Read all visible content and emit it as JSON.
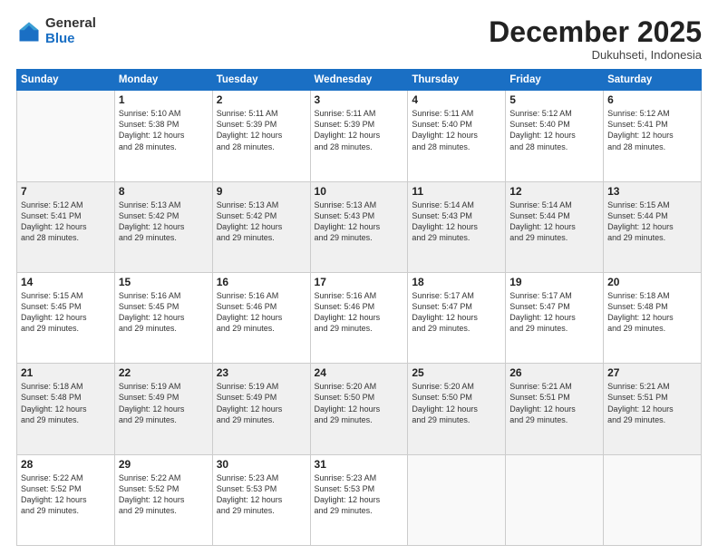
{
  "header": {
    "logo_general": "General",
    "logo_blue": "Blue",
    "month_title": "December 2025",
    "subtitle": "Dukuhseti, Indonesia"
  },
  "weekdays": [
    "Sunday",
    "Monday",
    "Tuesday",
    "Wednesday",
    "Thursday",
    "Friday",
    "Saturday"
  ],
  "weeks": [
    [
      {
        "day": "",
        "info": ""
      },
      {
        "day": "1",
        "info": "Sunrise: 5:10 AM\nSunset: 5:38 PM\nDaylight: 12 hours\nand 28 minutes."
      },
      {
        "day": "2",
        "info": "Sunrise: 5:11 AM\nSunset: 5:39 PM\nDaylight: 12 hours\nand 28 minutes."
      },
      {
        "day": "3",
        "info": "Sunrise: 5:11 AM\nSunset: 5:39 PM\nDaylight: 12 hours\nand 28 minutes."
      },
      {
        "day": "4",
        "info": "Sunrise: 5:11 AM\nSunset: 5:40 PM\nDaylight: 12 hours\nand 28 minutes."
      },
      {
        "day": "5",
        "info": "Sunrise: 5:12 AM\nSunset: 5:40 PM\nDaylight: 12 hours\nand 28 minutes."
      },
      {
        "day": "6",
        "info": "Sunrise: 5:12 AM\nSunset: 5:41 PM\nDaylight: 12 hours\nand 28 minutes."
      }
    ],
    [
      {
        "day": "7",
        "info": "Sunrise: 5:12 AM\nSunset: 5:41 PM\nDaylight: 12 hours\nand 28 minutes."
      },
      {
        "day": "8",
        "info": "Sunrise: 5:13 AM\nSunset: 5:42 PM\nDaylight: 12 hours\nand 29 minutes."
      },
      {
        "day": "9",
        "info": "Sunrise: 5:13 AM\nSunset: 5:42 PM\nDaylight: 12 hours\nand 29 minutes."
      },
      {
        "day": "10",
        "info": "Sunrise: 5:13 AM\nSunset: 5:43 PM\nDaylight: 12 hours\nand 29 minutes."
      },
      {
        "day": "11",
        "info": "Sunrise: 5:14 AM\nSunset: 5:43 PM\nDaylight: 12 hours\nand 29 minutes."
      },
      {
        "day": "12",
        "info": "Sunrise: 5:14 AM\nSunset: 5:44 PM\nDaylight: 12 hours\nand 29 minutes."
      },
      {
        "day": "13",
        "info": "Sunrise: 5:15 AM\nSunset: 5:44 PM\nDaylight: 12 hours\nand 29 minutes."
      }
    ],
    [
      {
        "day": "14",
        "info": "Sunrise: 5:15 AM\nSunset: 5:45 PM\nDaylight: 12 hours\nand 29 minutes."
      },
      {
        "day": "15",
        "info": "Sunrise: 5:16 AM\nSunset: 5:45 PM\nDaylight: 12 hours\nand 29 minutes."
      },
      {
        "day": "16",
        "info": "Sunrise: 5:16 AM\nSunset: 5:46 PM\nDaylight: 12 hours\nand 29 minutes."
      },
      {
        "day": "17",
        "info": "Sunrise: 5:16 AM\nSunset: 5:46 PM\nDaylight: 12 hours\nand 29 minutes."
      },
      {
        "day": "18",
        "info": "Sunrise: 5:17 AM\nSunset: 5:47 PM\nDaylight: 12 hours\nand 29 minutes."
      },
      {
        "day": "19",
        "info": "Sunrise: 5:17 AM\nSunset: 5:47 PM\nDaylight: 12 hours\nand 29 minutes."
      },
      {
        "day": "20",
        "info": "Sunrise: 5:18 AM\nSunset: 5:48 PM\nDaylight: 12 hours\nand 29 minutes."
      }
    ],
    [
      {
        "day": "21",
        "info": "Sunrise: 5:18 AM\nSunset: 5:48 PM\nDaylight: 12 hours\nand 29 minutes."
      },
      {
        "day": "22",
        "info": "Sunrise: 5:19 AM\nSunset: 5:49 PM\nDaylight: 12 hours\nand 29 minutes."
      },
      {
        "day": "23",
        "info": "Sunrise: 5:19 AM\nSunset: 5:49 PM\nDaylight: 12 hours\nand 29 minutes."
      },
      {
        "day": "24",
        "info": "Sunrise: 5:20 AM\nSunset: 5:50 PM\nDaylight: 12 hours\nand 29 minutes."
      },
      {
        "day": "25",
        "info": "Sunrise: 5:20 AM\nSunset: 5:50 PM\nDaylight: 12 hours\nand 29 minutes."
      },
      {
        "day": "26",
        "info": "Sunrise: 5:21 AM\nSunset: 5:51 PM\nDaylight: 12 hours\nand 29 minutes."
      },
      {
        "day": "27",
        "info": "Sunrise: 5:21 AM\nSunset: 5:51 PM\nDaylight: 12 hours\nand 29 minutes."
      }
    ],
    [
      {
        "day": "28",
        "info": "Sunrise: 5:22 AM\nSunset: 5:52 PM\nDaylight: 12 hours\nand 29 minutes."
      },
      {
        "day": "29",
        "info": "Sunrise: 5:22 AM\nSunset: 5:52 PM\nDaylight: 12 hours\nand 29 minutes."
      },
      {
        "day": "30",
        "info": "Sunrise: 5:23 AM\nSunset: 5:53 PM\nDaylight: 12 hours\nand 29 minutes."
      },
      {
        "day": "31",
        "info": "Sunrise: 5:23 AM\nSunset: 5:53 PM\nDaylight: 12 hours\nand 29 minutes."
      },
      {
        "day": "",
        "info": ""
      },
      {
        "day": "",
        "info": ""
      },
      {
        "day": "",
        "info": ""
      }
    ]
  ]
}
